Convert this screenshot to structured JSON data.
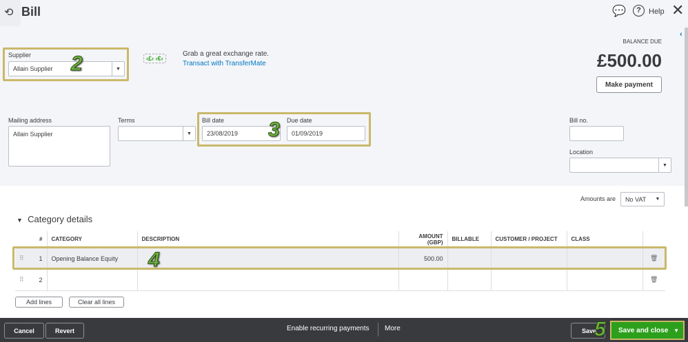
{
  "header": {
    "title": "Bill",
    "help": "Help"
  },
  "supplier": {
    "label": "Supplier",
    "value": "Allain Supplier"
  },
  "promo": {
    "text": "Grab a great exchange rate.",
    "link": "Transact with TransferMate"
  },
  "balance": {
    "label": "BALANCE DUE",
    "amount": "£500.00",
    "make_payment": "Make payment"
  },
  "mailing": {
    "label": "Mailing address",
    "value": "Allain Supplier"
  },
  "terms": {
    "label": "Terms",
    "value": ""
  },
  "bill_date": {
    "label": "Bill date",
    "value": "23/08/2019"
  },
  "due_date": {
    "label": "Due date",
    "value": "01/09/2019"
  },
  "bill_no": {
    "label": "Bill no.",
    "value": ""
  },
  "location": {
    "label": "Location",
    "value": ""
  },
  "amounts": {
    "label": "Amounts are",
    "value": "No VAT"
  },
  "section": {
    "title": "Category details"
  },
  "table": {
    "headers": [
      "#",
      "CATEGORY",
      "DESCRIPTION",
      "AMOUNT (GBP)",
      "BILLABLE",
      "CUSTOMER / PROJECT",
      "CLASS"
    ],
    "rows": [
      {
        "n": "1",
        "category": "Opening Balance Equity",
        "description": "",
        "amount": "500.00"
      },
      {
        "n": "2",
        "category": "",
        "description": "",
        "amount": ""
      }
    ]
  },
  "buttons": {
    "add_lines": "Add lines",
    "clear_lines": "Clear all lines"
  },
  "footer": {
    "cancel": "Cancel",
    "revert": "Revert",
    "recurring": "Enable recurring payments",
    "more": "More",
    "save": "Save",
    "save_close": "Save and close"
  },
  "annotations": [
    "2",
    "3",
    "4",
    "5"
  ],
  "colors": {
    "accent": "#2ca01c",
    "link": "#0077c5",
    "highlight": "#c9b86a"
  }
}
